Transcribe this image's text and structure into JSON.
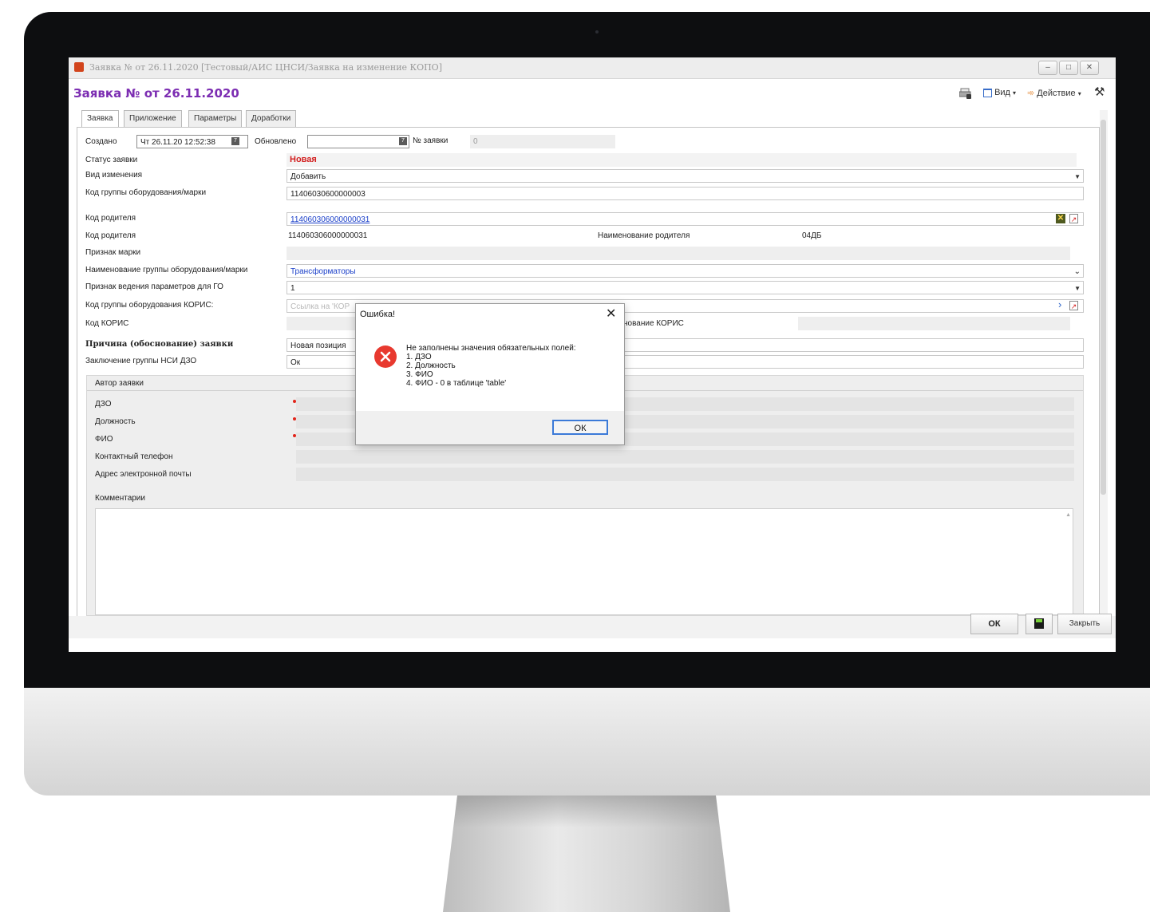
{
  "window": {
    "title": "Заявка № от 26.11.2020 [Тестовый/АИС ЦНСИ/Заявка на изменение КОПО]",
    "page_title": "Заявка № от 26.11.2020",
    "minimize": "–",
    "maximize": "□",
    "close": "✕"
  },
  "toolbar": {
    "view_label": "Вид",
    "action_label": "Действие"
  },
  "tabs": [
    {
      "label": "Заявка",
      "active": true
    },
    {
      "label": "Приложение",
      "active": false
    },
    {
      "label": "Параметры",
      "active": false
    },
    {
      "label": "Доработки",
      "active": false
    }
  ],
  "form": {
    "created_label": "Создано",
    "created_value": "Чт 26.11.20 12:52:38",
    "updated_label": "Обновлено",
    "updated_value": "",
    "number_label": "№ заявки",
    "number_value": "0",
    "status_label": "Статус заявки",
    "status_value": "Новая",
    "change_type_label": "Вид изменения",
    "change_type_value": "Добавить",
    "group_code_label": "Код группы оборудования/марки",
    "group_code_value": "11406030600000003",
    "parent_code_label": "Код родителя",
    "parent_code_link": "114060306000000031",
    "parent_code2_label": "Код родителя",
    "parent_code2_value": "114060306000000031",
    "parent_name_label": "Наименование родителя",
    "parent_name_value": "04ДБ",
    "brand_sign_label": "Признак марки",
    "group_name_label": "Наименование группы оборудования/марки",
    "group_name_value": "Трансформаторы",
    "params_sign_label": "Признак ведения параметров для ГО",
    "params_sign_value": "1",
    "koris_group_label": "Код группы оборудования КОРИС:",
    "koris_group_placeholder": "Ссылка на 'КОР",
    "koris_code_label": "Код КОРИС",
    "koris_name_label": "нование КОРИС",
    "reason_label": "Причина (обоснование) заявки",
    "reason_value": "Новая позиция",
    "conclusion_label": "Заключение группы НСИ ДЗО",
    "conclusion_value": "Ок"
  },
  "author": {
    "section_label": "Автор заявки",
    "dzo_label": "ДЗО",
    "position_label": "Должность",
    "fio_label": "ФИО",
    "phone_label": "Контактный телефон",
    "email_label": "Адрес электронной почты",
    "comments_label": "Комментарии"
  },
  "buttons": {
    "ok": "ОК",
    "close": "Закрыть"
  },
  "dialog": {
    "title": "Ошибка!",
    "close": "✕",
    "message_lines": [
      "Не заполнены значения обязательных полей:",
      "1. ДЗО",
      "2. Должность",
      "3. ФИО",
      "4. ФИО - 0 в таблице 'table'"
    ],
    "ok": "ОК"
  },
  "colors": {
    "title_purple": "#7c2db2",
    "status_red": "#d32020",
    "link_blue": "#1a3fc9",
    "error_red": "#e8392f"
  }
}
